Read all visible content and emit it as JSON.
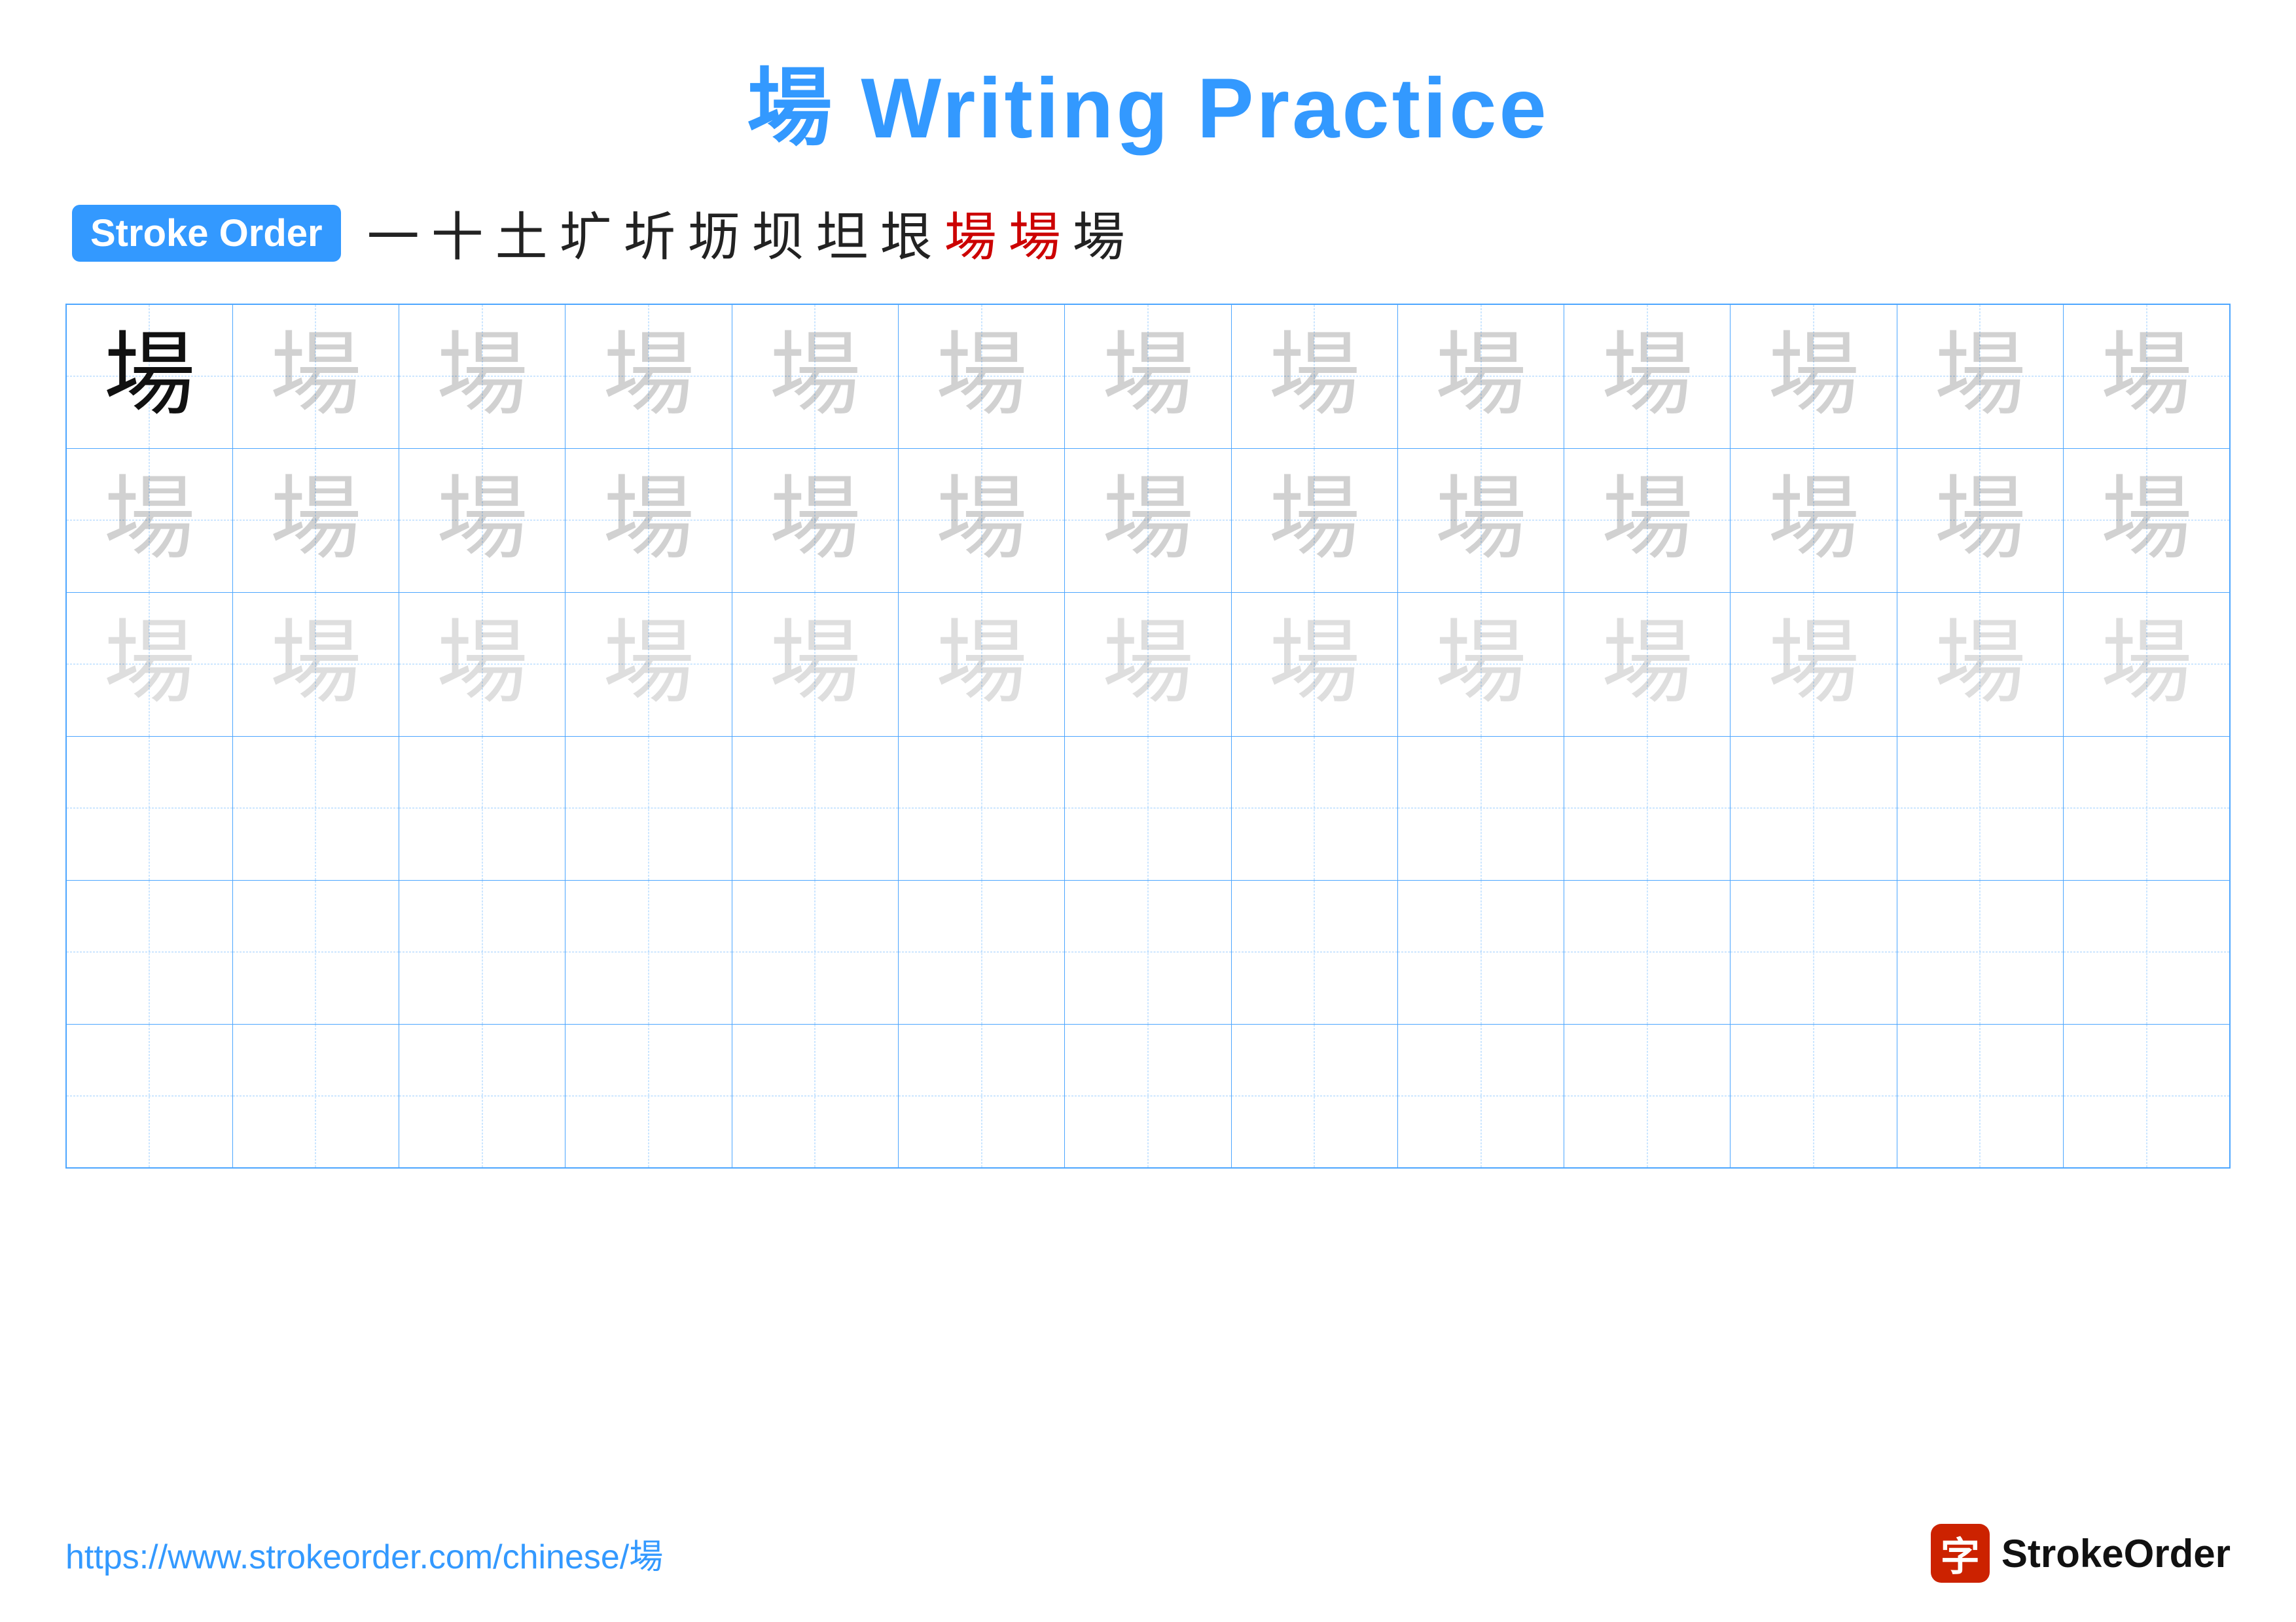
{
  "title": {
    "text": "場 Writing Practice"
  },
  "stroke_order": {
    "badge_label": "Stroke Order",
    "strokes": [
      {
        "char": "一",
        "style": "normal"
      },
      {
        "char": "十",
        "style": "normal"
      },
      {
        "char": "土",
        "style": "normal"
      },
      {
        "char": "圹",
        "style": "normal"
      },
      {
        "char": "圻",
        "style": "normal"
      },
      {
        "char": "坜",
        "style": "normal"
      },
      {
        "char": "坝",
        "style": "normal"
      },
      {
        "char": "坦",
        "style": "normal"
      },
      {
        "char": "垠",
        "style": "normal"
      },
      {
        "char": "場",
        "style": "red"
      },
      {
        "char": "場",
        "style": "red"
      },
      {
        "char": "場",
        "style": "normal"
      }
    ]
  },
  "practice_rows": [
    {
      "type": "solid_then_light1",
      "char": "場",
      "cols": 13
    },
    {
      "type": "light1",
      "char": "場",
      "cols": 13
    },
    {
      "type": "light2",
      "char": "場",
      "cols": 13
    },
    {
      "type": "empty",
      "cols": 13
    },
    {
      "type": "empty",
      "cols": 13
    },
    {
      "type": "empty",
      "cols": 13
    }
  ],
  "footer": {
    "url": "https://www.strokeorder.com/chinese/場",
    "logo_char": "字",
    "logo_name": "StrokeOrder"
  }
}
